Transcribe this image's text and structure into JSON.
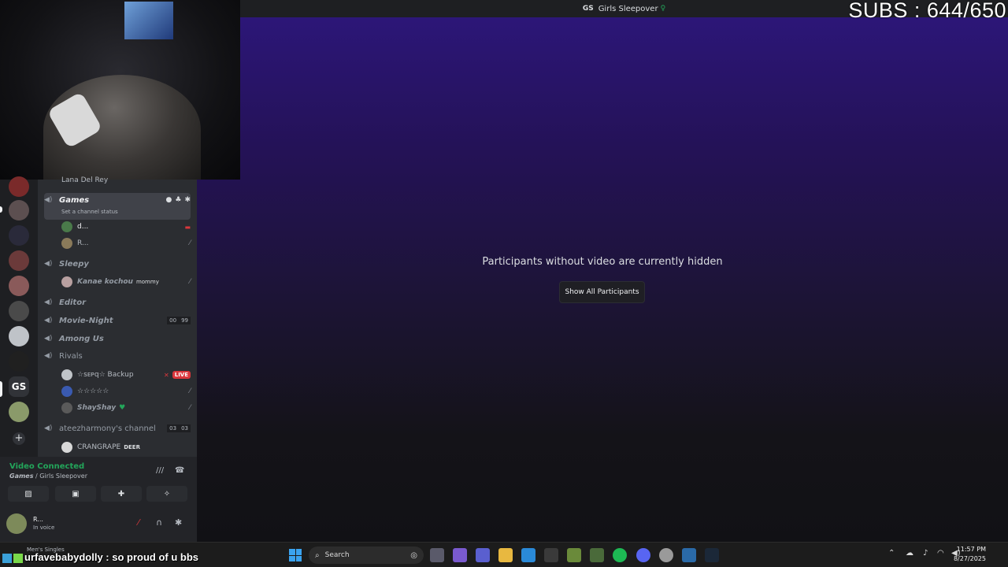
{
  "window": {
    "server_badge": "GS",
    "title": "Girls Sleepover"
  },
  "overlay": {
    "subs": "SUBS : 644/650",
    "chat_small": "Men's Singles",
    "chat_message": "urfavebabydolly : so proud of u bbs"
  },
  "main": {
    "hidden_message": "Participants without video are currently hidden",
    "show_button": "Show All Participants"
  },
  "rail": {
    "gs_label": "GS",
    "add_label": "+"
  },
  "channels": {
    "partial_top": "Lana Del Rey",
    "games": {
      "name": "Games",
      "status": "Set a channel status"
    },
    "games_users": [
      {
        "name": "d..."
      },
      {
        "name": "R..."
      }
    ],
    "sleepy": {
      "name": "Sleepy"
    },
    "sleepy_user": {
      "name": "Kanae kochou",
      "tag": "mommy"
    },
    "editor": {
      "name": "Editor"
    },
    "movie_night": {
      "name": "Movie-Night",
      "count_a": "00",
      "count_b": "99"
    },
    "among_us": {
      "name": "Among Us"
    },
    "rivals": {
      "name": "Rivals"
    },
    "rivals_users": [
      {
        "name": "☆ꜱᴇᴘq☆ Backup",
        "badge": "LIVE"
      },
      {
        "name": "☆☆☆☆☆"
      },
      {
        "name": "ShayShay"
      }
    ],
    "ateez": {
      "name": "ateezharmony's channel",
      "count_a": "03",
      "count_b": "03"
    },
    "ateez_user": {
      "name": "CRANGRAPE",
      "tag": "DEER"
    }
  },
  "voice": {
    "status": "Video Connected",
    "channel": "Games",
    "server": "/ Girls Sleepover",
    "me_name": "R...",
    "me_status": "In voice"
  },
  "taskbar": {
    "search_placeholder": "Search",
    "time": "11:57 PM",
    "date": "8/27/2025"
  }
}
